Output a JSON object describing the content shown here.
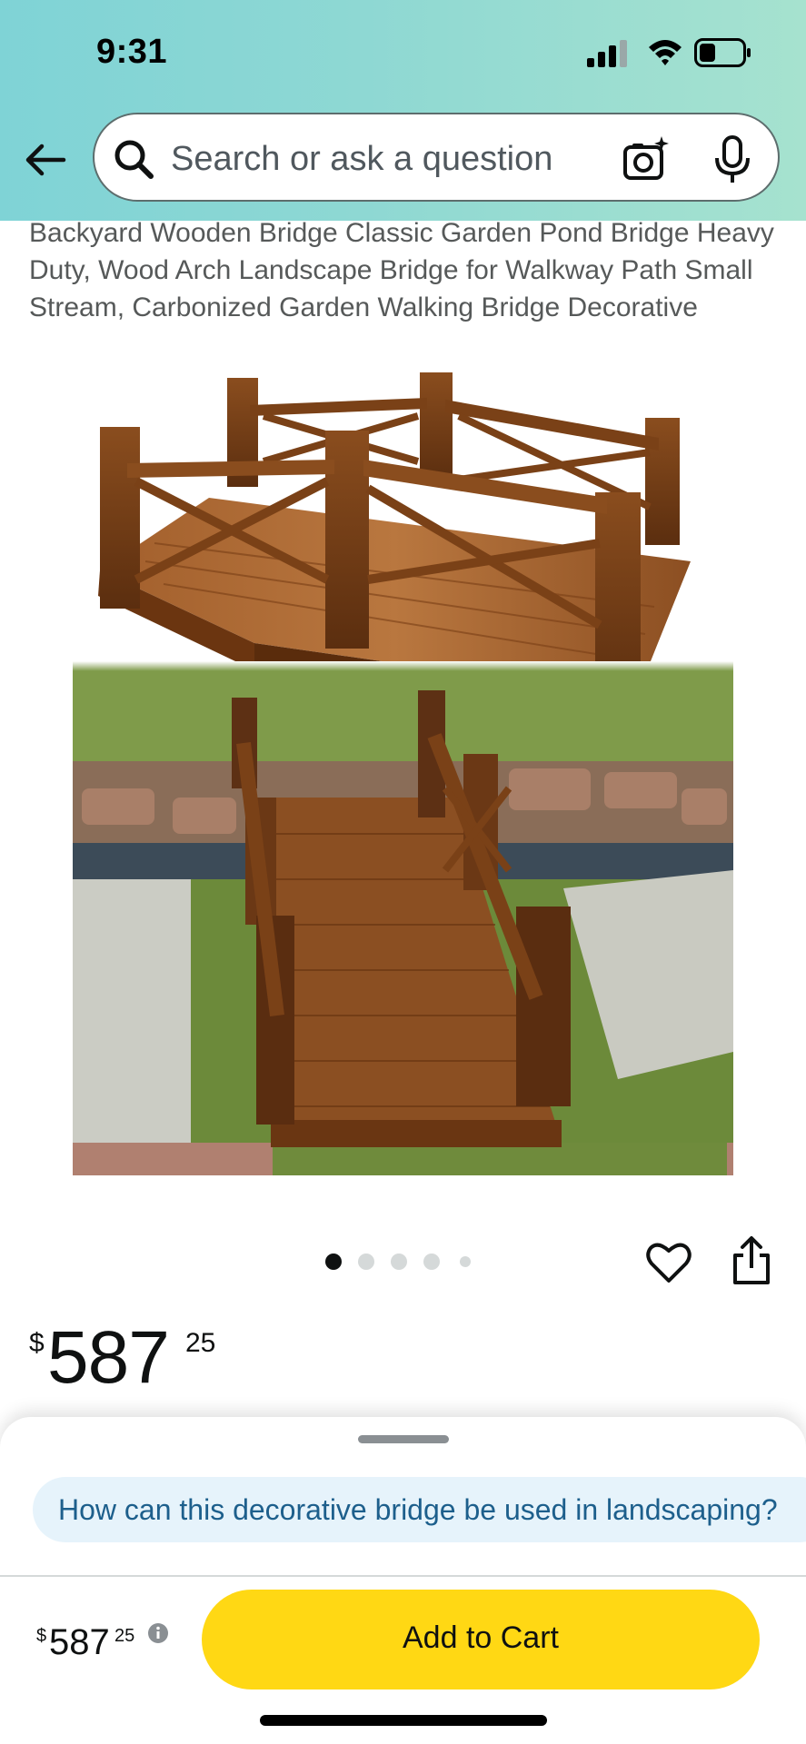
{
  "status_bar": {
    "time": "9:31",
    "icons": [
      "signal-icon",
      "wifi-icon",
      "battery-icon"
    ]
  },
  "header": {
    "back_icon": "back-arrow-icon",
    "search": {
      "placeholder": "Search or ask a question",
      "icons": [
        "search-icon",
        "camera-icon",
        "mic-icon"
      ]
    }
  },
  "product": {
    "title": "Backyard Wooden Bridge Classic Garden Pond Bridge Heavy Duty, Wood Arch Landscape Bridge for Walkway Path Small Stream, Carbonized Garden Walking Bridge Decorative",
    "carousel": {
      "count": 5,
      "active_index": 0
    },
    "price": {
      "symbol": "$",
      "whole": "587",
      "fraction": "25"
    }
  },
  "bottom_sheet": {
    "suggestion": "How can this decorative bridge be used in landscaping?",
    "price": {
      "symbol": "$",
      "whole": "587",
      "fraction": "25"
    },
    "add_to_cart_label": "Add to Cart"
  },
  "colors": {
    "header_gradient_start": "#7fd3d6",
    "header_gradient_end": "#a6e2cf",
    "add_to_cart": "#ffd814",
    "suggestion_bg": "#e6f3fb",
    "suggestion_text": "#1d5f8c"
  }
}
